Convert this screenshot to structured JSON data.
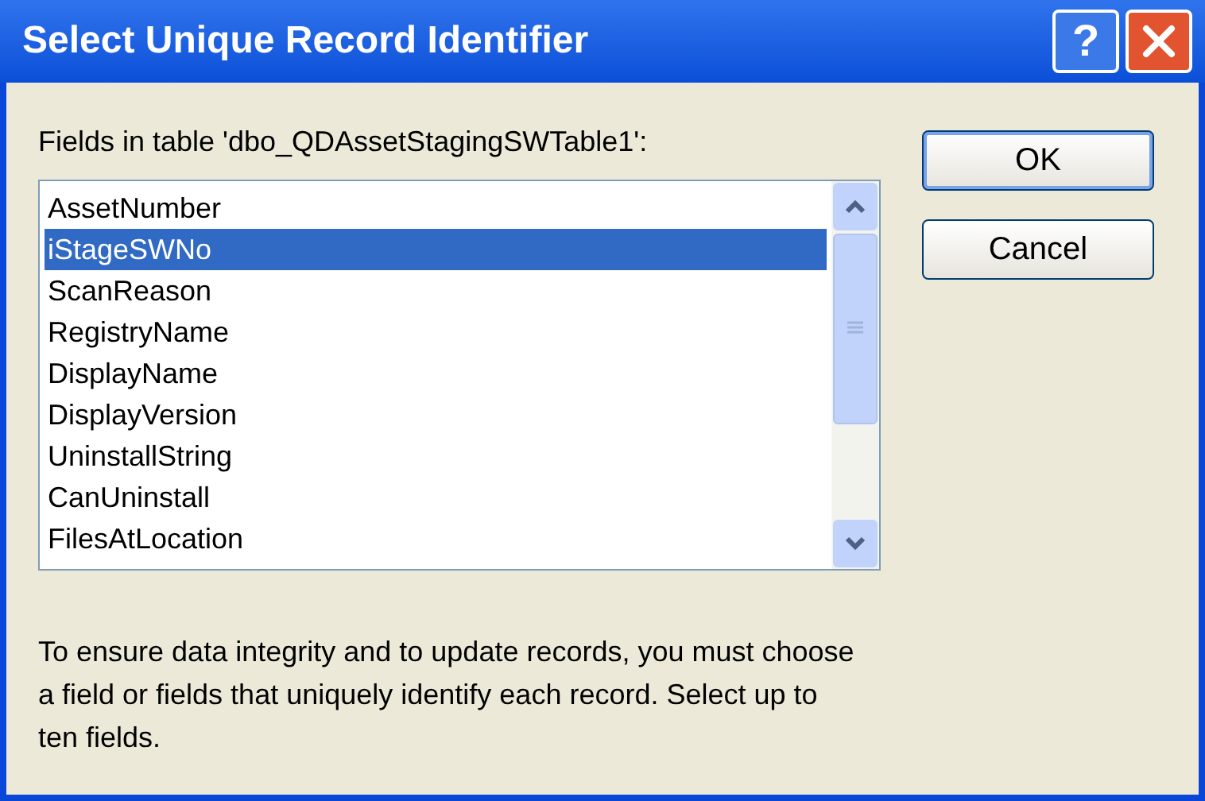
{
  "window": {
    "title": "Select Unique Record Identifier",
    "title_buttons": [
      {
        "kind": "help",
        "label": "?"
      },
      {
        "kind": "close"
      }
    ]
  },
  "fields_label": "Fields in table 'dbo_QDAssetStagingSWTable1':",
  "fields": [
    {
      "label": "AssetNumber",
      "selected": false
    },
    {
      "label": "iStageSWNo",
      "selected": true
    },
    {
      "label": "ScanReason",
      "selected": false
    },
    {
      "label": "RegistryName",
      "selected": false
    },
    {
      "label": "DisplayName",
      "selected": false
    },
    {
      "label": "DisplayVersion",
      "selected": false
    },
    {
      "label": "UninstallString",
      "selected": false
    },
    {
      "label": "CanUninstall",
      "selected": false
    },
    {
      "label": "FilesAtLocation",
      "selected": false
    }
  ],
  "buttons": [
    {
      "label": "OK",
      "default": true
    },
    {
      "label": "Cancel",
      "default": false
    }
  ],
  "note": "To ensure data integrity and to update records, you must choose a field or fields that uniquely identify each record. Select up to ten fields."
}
